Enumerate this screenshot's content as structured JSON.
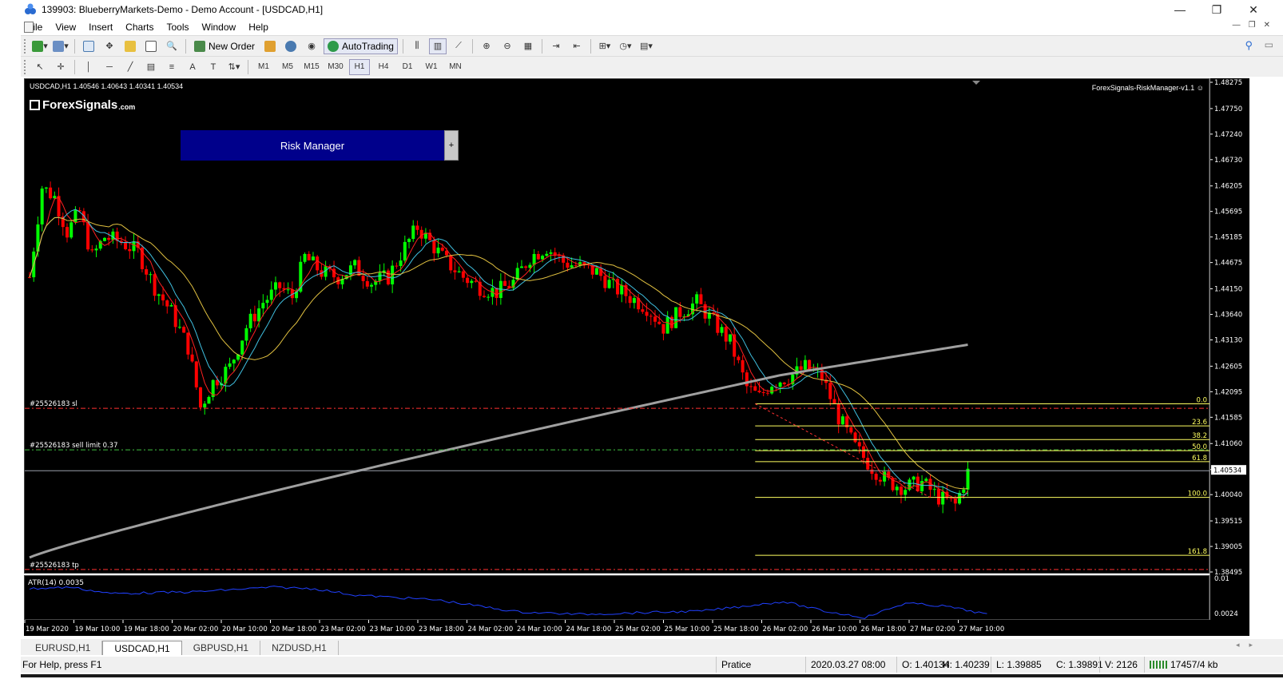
{
  "window": {
    "title": "139903: BlueberryMarkets-Demo - Demo Account - [USDCAD,H1]",
    "controls": [
      "—",
      "❐",
      "✕"
    ]
  },
  "menu": [
    "File",
    "View",
    "Insert",
    "Charts",
    "Tools",
    "Window",
    "Help"
  ],
  "toolbar": {
    "new_order": "New Order",
    "auto_trading": "AutoTrading",
    "timeframes": [
      "M1",
      "M5",
      "M15",
      "M30",
      "H1",
      "H4",
      "D1",
      "W1",
      "MN"
    ],
    "active_timeframe": "H1"
  },
  "chart": {
    "symbol_info": "USDCAD,H1  1.40546 1.40643 1.40341 1.40534",
    "ea_label": "ForexSignals-RiskManager-v1.1 ☺",
    "logo_main": "ForexSignals",
    "logo_sub": ".com",
    "risk_manager_label": "Risk Manager",
    "risk_manager_plus": "+",
    "order_sl_label": "#25526183 sl",
    "order_sell_label": "#25526183 sell limit 0.37",
    "order_tp_label": "#25526183 tp",
    "fib_levels": [
      "0.0",
      "23.6",
      "38.2",
      "50.0",
      "61.8",
      "100.0",
      "161.8"
    ],
    "current_price": "1.40534",
    "price_ticks": [
      "1.48275",
      "1.47750",
      "1.47240",
      "1.46730",
      "1.46205",
      "1.45695",
      "1.45185",
      "1.44675",
      "1.44150",
      "1.43640",
      "1.43130",
      "1.42605",
      "1.42095",
      "1.41585",
      "1.41060",
      "1.40540",
      "1.40040",
      "1.39515",
      "1.39005",
      "1.38495"
    ],
    "indicator_label": "ATR(14) 0.0035",
    "indicator_ticks": [
      "0.01",
      "0.0024"
    ],
    "time_ticks": [
      "19 Mar 2020",
      "19 Mar 10:00",
      "19 Mar 18:00",
      "20 Mar 02:00",
      "20 Mar 10:00",
      "20 Mar 18:00",
      "23 Mar 02:00",
      "23 Mar 10:00",
      "23 Mar 18:00",
      "24 Mar 02:00",
      "24 Mar 10:00",
      "24 Mar 18:00",
      "25 Mar 02:00",
      "25 Mar 10:00",
      "25 Mar 18:00",
      "26 Mar 02:00",
      "26 Mar 10:00",
      "26 Mar 18:00",
      "27 Mar 02:00",
      "27 Mar 10:00"
    ],
    "colors": {
      "bull": "#00ff00",
      "bear": "#ff0000",
      "ma_fast": "#ff2020",
      "ma_mid": "#40c0e0",
      "ma_slow": "#e0c040",
      "ma_long": "#a0a0a0",
      "fib": "#ffff60",
      "order_line": "#ff3030",
      "sell_line": "#40c040",
      "atr": "#2040ff"
    }
  },
  "tabs": [
    "EURUSD,H1",
    "USDCAD,H1",
    "GBPUSD,H1",
    "NZDUSD,H1"
  ],
  "active_tab": "USDCAD,H1",
  "status": {
    "help": "For Help, press F1",
    "profile": "Pratice",
    "datetime": "2020.03.27 08:00",
    "open": "O: 1.40134",
    "high": "H: 1.40239",
    "low": "L: 1.39885",
    "close": "C: 1.39891",
    "volume": "V: 2126",
    "traffic": "17457/4 kb"
  }
}
